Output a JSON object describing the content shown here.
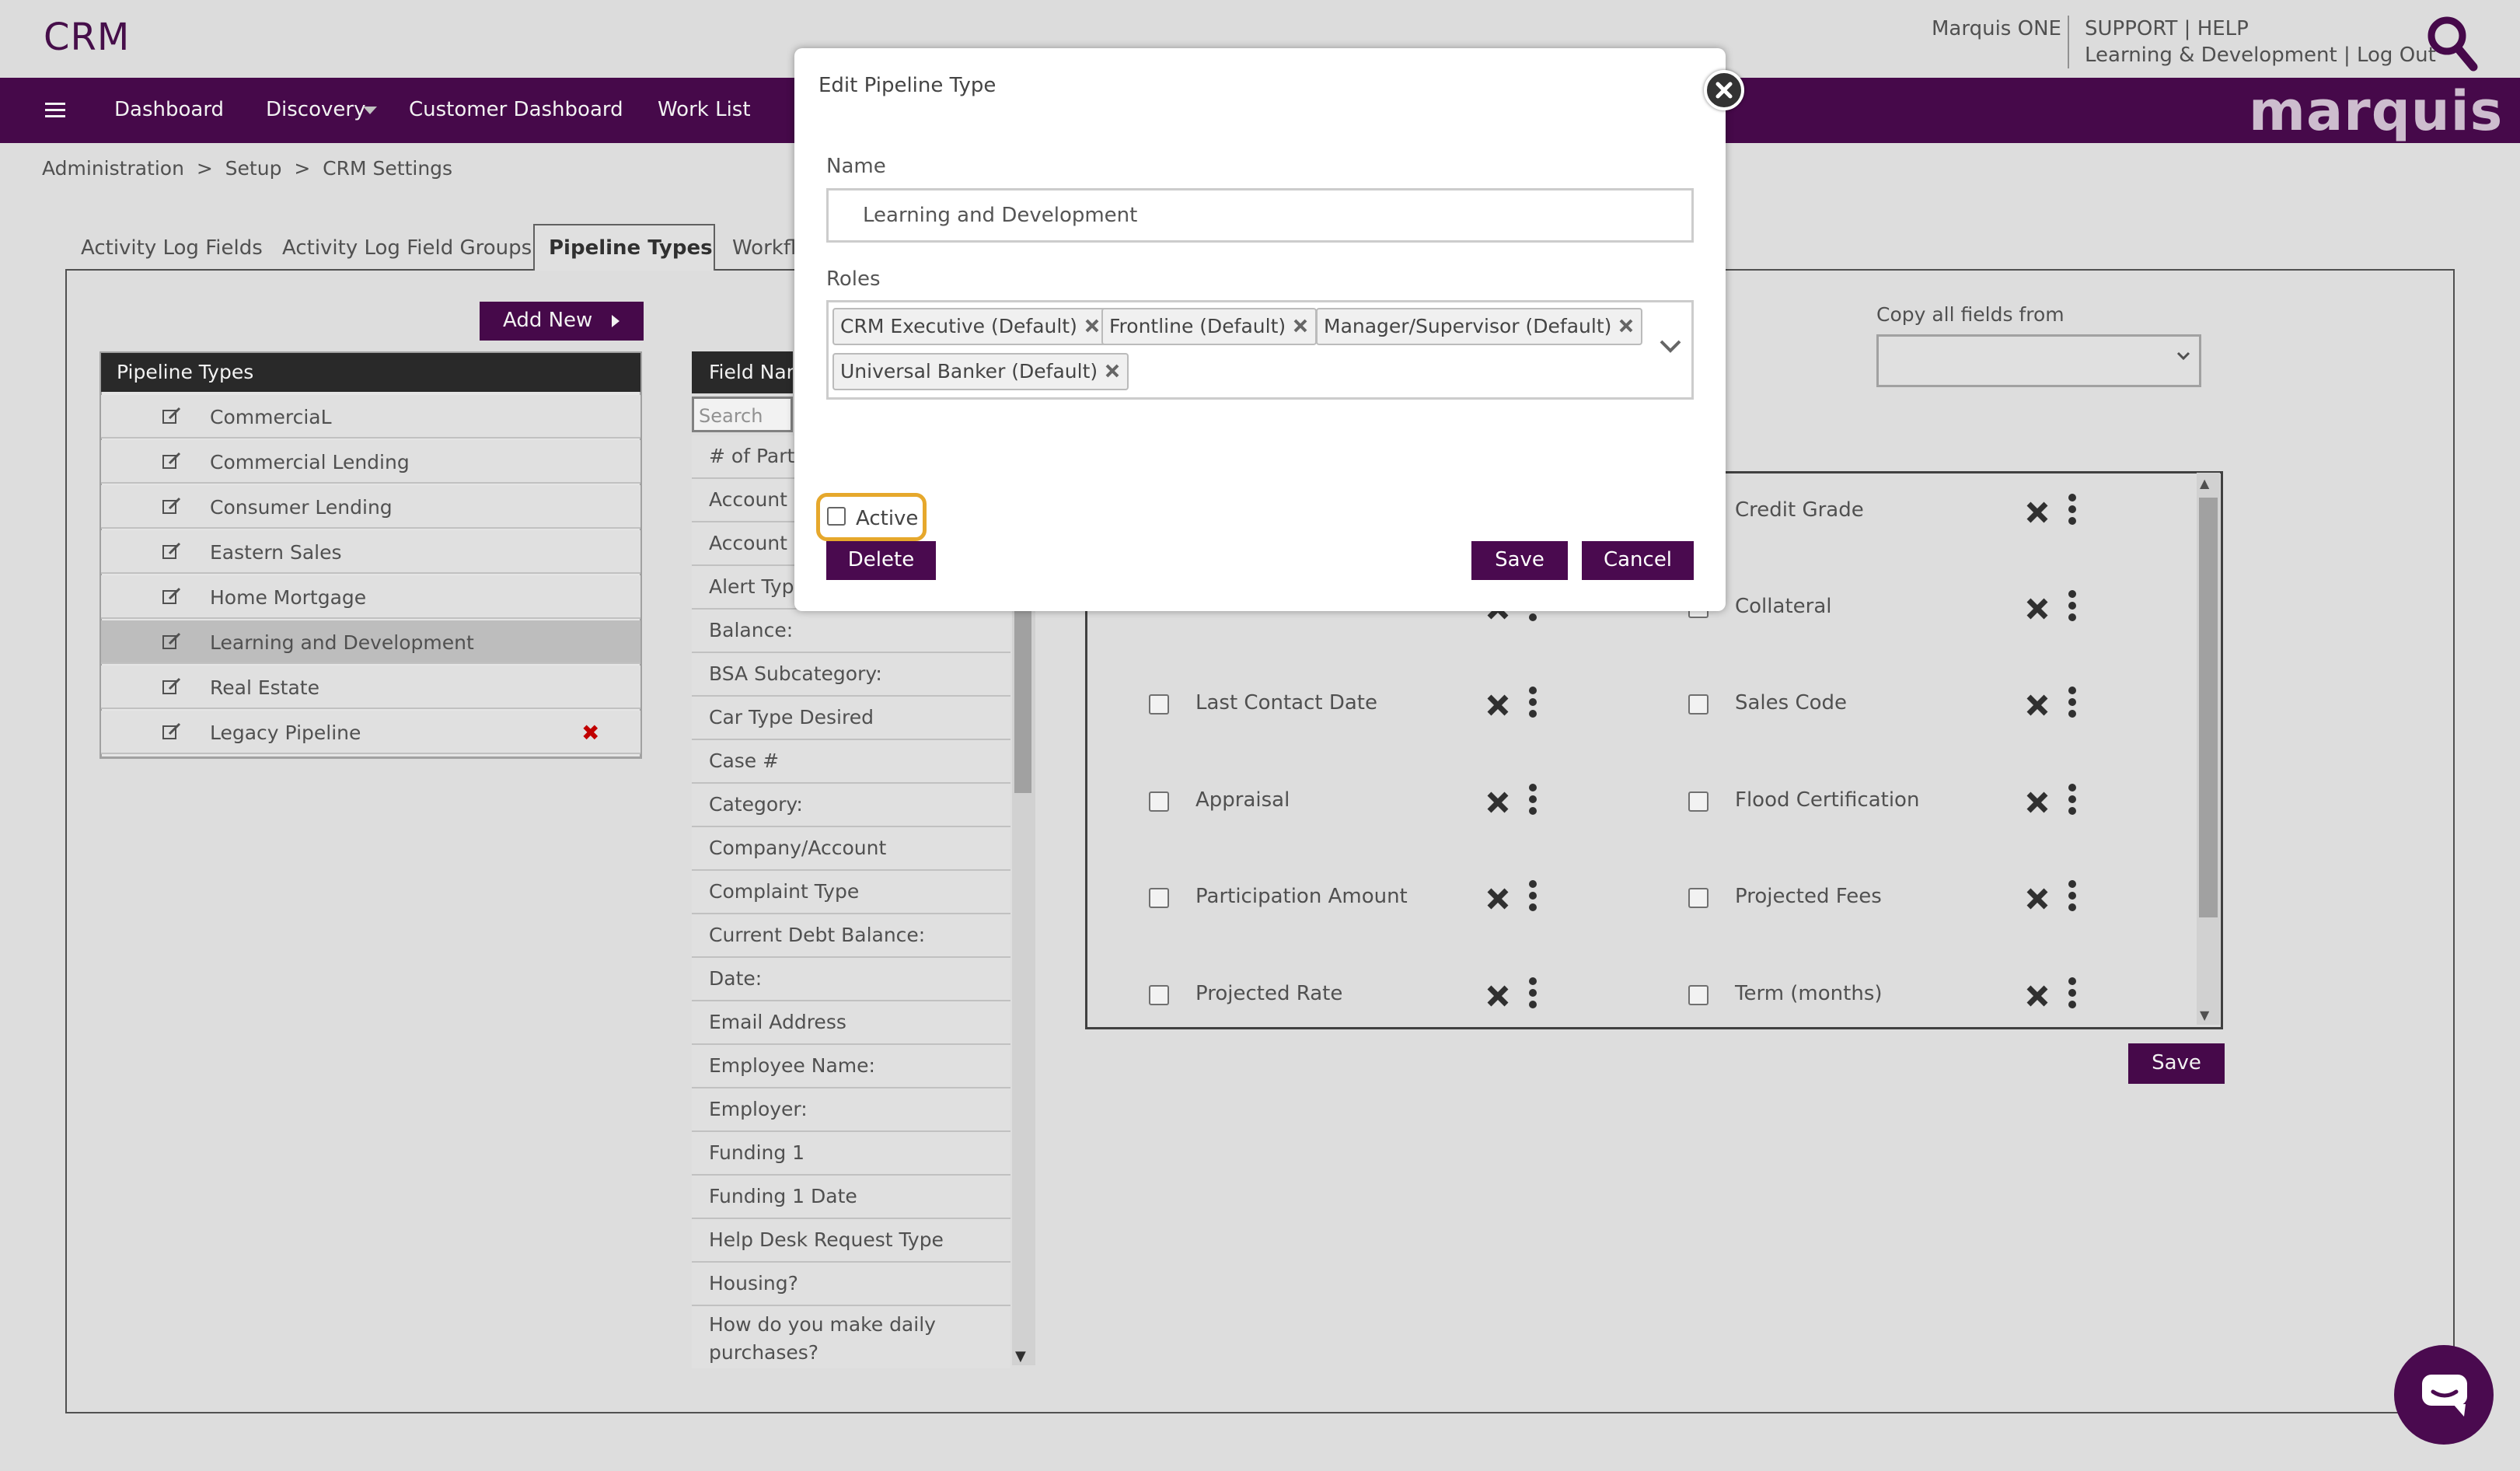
{
  "app": {
    "title": "CRM",
    "brand": "marquis"
  },
  "header": {
    "user": "Marquis ONE",
    "links_line1": "SUPPORT | HELP",
    "links_line2": "Learning & Development | Log Out"
  },
  "nav": {
    "items": [
      "Dashboard",
      "Discovery",
      "Customer Dashboard",
      "Work List"
    ]
  },
  "breadcrumb": "Administration  >  Setup  >  CRM Settings",
  "tabs": [
    "Activity Log Fields",
    "Activity Log Field Groups",
    "Pipeline Types",
    "Workfl"
  ],
  "left_panel": {
    "add_new_label": "Add New",
    "header": "Pipeline Types",
    "items": [
      "CommerciaL",
      "Commercial Lending",
      "Consumer Lending",
      "Eastern Sales",
      "Home Mortgage",
      "Learning and Development",
      "Real Estate",
      "Legacy Pipeline"
    ],
    "selected_index": 5
  },
  "field_list": {
    "header": "Field Nam",
    "search_placeholder": "Search",
    "items": [
      "# of Part",
      "Account",
      "Account",
      "Alert Typ",
      "Balance:",
      "BSA Subcategory:",
      "Car Type Desired",
      "Case #",
      "Category:",
      "Company/Account",
      "Complaint Type",
      "Current Debt Balance:",
      "Date:",
      "Email Address",
      "Employee Name:",
      "Employer:",
      "Funding 1",
      "Funding 1 Date",
      "Help Desk Request Type",
      "Housing?",
      "How do you make daily purchases?"
    ]
  },
  "copy_fields": {
    "label": "Copy all fields from",
    "value": ""
  },
  "fields_grid": {
    "left": [
      "",
      "",
      "Last Contact Date",
      "Appraisal",
      "Participation Amount",
      "Projected Rate"
    ],
    "right": [
      "Credit Grade",
      "Collateral",
      "Sales Code",
      "Flood Certification",
      "Projected Fees",
      "Term (months)"
    ]
  },
  "page_save_label": "Save",
  "modal": {
    "title": "Edit Pipeline Type",
    "name_label": "Name",
    "name_value": "Learning and Development",
    "roles_label": "Roles",
    "roles": [
      "CRM Executive (Default)",
      "Frontline (Default)",
      "Manager/Supervisor (Default)",
      "Universal Banker (Default)"
    ],
    "active_label": "Active",
    "active_checked": false,
    "delete_label": "Delete",
    "save_label": "Save",
    "cancel_label": "Cancel"
  },
  "colors": {
    "brand_purple": "#4a0a4f",
    "focus_ring": "#e6a82c",
    "delete_red": "#cc0000"
  },
  "icons": [
    "menu-icon",
    "search-icon",
    "chevron-down-icon",
    "edit-icon",
    "remove-icon",
    "close-icon",
    "chat-icon",
    "kebab-icon"
  ]
}
